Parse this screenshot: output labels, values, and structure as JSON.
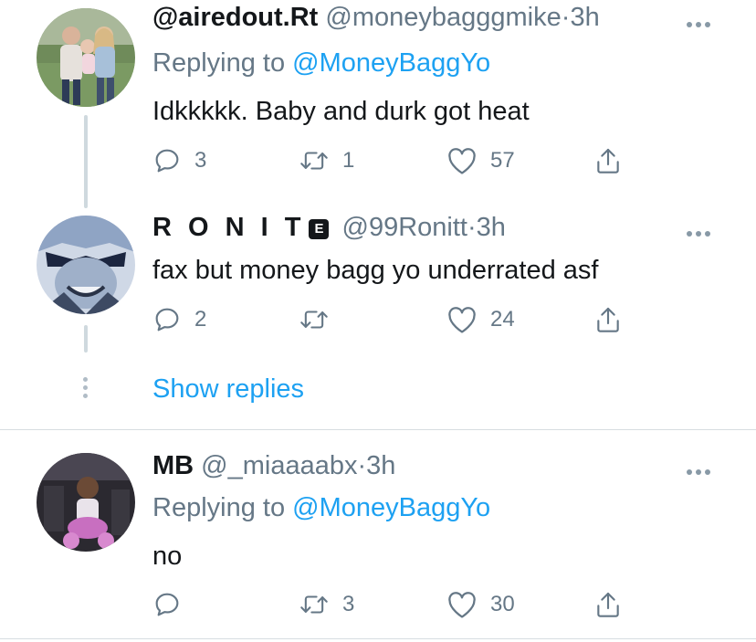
{
  "tweets": [
    {
      "display_name": "@airedout.Rt",
      "handle": "@moneybagggmike",
      "time": "3h",
      "replying_prefix": "Replying to",
      "replying_to": "@MoneyBaggYo",
      "text": "Idkkkkk. Baby and durk got heat",
      "reply_count": "3",
      "retweet_count": "1",
      "like_count": "57"
    },
    {
      "display_name": "R O N I T",
      "badge": "E",
      "handle": "@99Ronitt",
      "time": "3h",
      "text": "fax but money bagg yo underrated asf",
      "reply_count": "2",
      "retweet_count": "",
      "like_count": "24"
    },
    {
      "display_name": "MB",
      "handle": "@_miaaaabx",
      "time": "3h",
      "replying_prefix": "Replying to",
      "replying_to": "@MoneyBaggYo",
      "text": "no",
      "reply_count": "",
      "retweet_count": "3",
      "like_count": "30"
    }
  ],
  "show_replies_label": "Show replies",
  "separator": "·",
  "colors": {
    "link": "#1da1f2",
    "secondary": "#657786",
    "text": "#14171a"
  },
  "icons": [
    "reply-icon",
    "retweet-icon",
    "like-icon",
    "share-icon",
    "more-icon"
  ]
}
